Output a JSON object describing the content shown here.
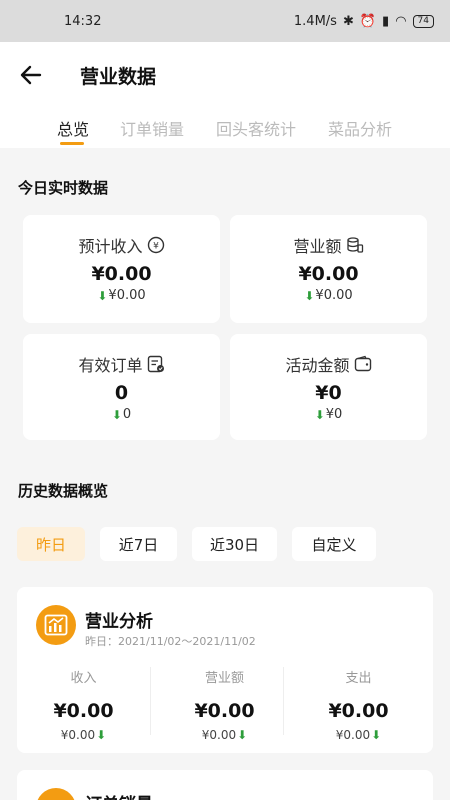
{
  "status_bar": {
    "time": "14:32",
    "net_speed": "1.4M/s",
    "battery": "74"
  },
  "header": {
    "title": "营业数据"
  },
  "tabs": [
    {
      "label": "总览"
    },
    {
      "label": "订单销量"
    },
    {
      "label": "回头客统计"
    },
    {
      "label": "菜品分析"
    }
  ],
  "realtime": {
    "title": "今日实时数据",
    "cards": [
      {
        "label": "预计收入",
        "value": "¥0.00",
        "delta": "¥0.00",
        "icon": "yen-coin-icon"
      },
      {
        "label": "营业额",
        "value": "¥0.00",
        "delta": "¥0.00",
        "icon": "coin-stack-icon"
      },
      {
        "label": "有效订单",
        "value": "0",
        "delta": "0",
        "icon": "order-check-icon"
      },
      {
        "label": "活动金额",
        "value": "¥0",
        "delta": "¥0",
        "icon": "wallet-icon"
      }
    ]
  },
  "history": {
    "title": "历史数据概览",
    "filters": [
      {
        "label": "昨日"
      },
      {
        "label": "近7日"
      },
      {
        "label": "近30日"
      },
      {
        "label": "自定义"
      }
    ],
    "selected_filter": "昨日"
  },
  "analysis": {
    "title": "营业分析",
    "date": "昨日：2021/11/02～2021/11/02",
    "icon": "bar-chart-icon",
    "columns": [
      {
        "label": "收入",
        "value": "¥0.00",
        "delta": "¥0.00"
      },
      {
        "label": "营业额",
        "value": "¥0.00",
        "delta": "¥0.00"
      },
      {
        "label": "支出",
        "value": "¥0.00",
        "delta": "¥0.00"
      }
    ]
  },
  "next_card": {
    "title": "订单销量"
  },
  "colors": {
    "accent": "#f39c12",
    "down": "#2e9e3b"
  }
}
